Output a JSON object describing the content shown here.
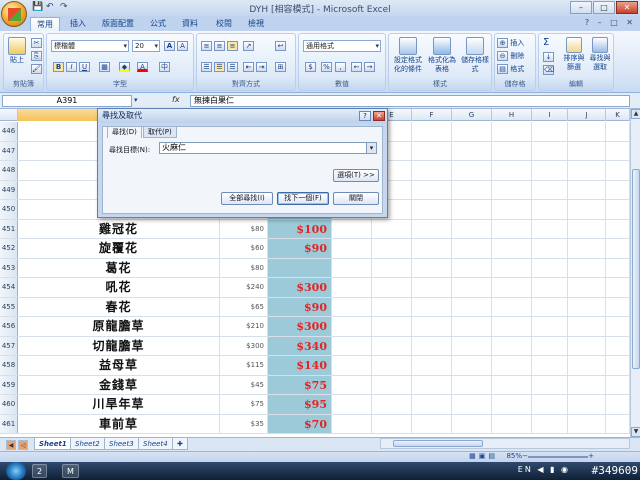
{
  "window": {
    "title": "DYH [相容模式] - Microsoft Excel",
    "qat": [
      "💾",
      "↶",
      "↷"
    ]
  },
  "tabs": [
    {
      "label": "常用",
      "active": true
    },
    {
      "label": "插入",
      "active": false
    },
    {
      "label": "版面配置",
      "active": false
    },
    {
      "label": "公式",
      "active": false
    },
    {
      "label": "資料",
      "active": false
    },
    {
      "label": "校閱",
      "active": false
    },
    {
      "label": "檢視",
      "active": false
    }
  ],
  "ribbon": {
    "clipboard": {
      "label": "剪貼簿",
      "paste": "貼上"
    },
    "font": {
      "label": "字型",
      "font_name": "標楷體",
      "font_size": "20",
      "grow": "A",
      "shrink": "A",
      "bold": "B",
      "italic": "I",
      "underline": "U",
      "fill_color": "#ffff00",
      "font_color": "#ff0000"
    },
    "alignment": {
      "label": "對齊方式"
    },
    "number": {
      "label": "數值",
      "format": "通用格式",
      "currency": "$",
      "percent": "%",
      "comma": ","
    },
    "styles": {
      "label": "樣式",
      "cond_format": "設定格式化的條件",
      "table_format": "格式化為表格",
      "cell_styles": "儲存格樣式"
    },
    "cells": {
      "label": "儲存格",
      "insert": "插入",
      "delete": "刪除",
      "format": "格式"
    },
    "editing": {
      "label": "編輯",
      "sum": "Σ",
      "sort": "排序與篩選",
      "find": "尋找與選取"
    }
  },
  "formula_bar": {
    "name_box": "A391",
    "fx": "fx",
    "content": "無揀白果仁"
  },
  "columns": [
    "D",
    "E",
    "F",
    "G",
    "H",
    "I",
    "J",
    "K"
  ],
  "rows": [
    {
      "num": "446",
      "name": "",
      "price": "",
      "sale": ""
    },
    {
      "num": "447",
      "name": "",
      "price": "",
      "sale": ""
    },
    {
      "num": "448",
      "name": "",
      "price": "",
      "sale": ""
    },
    {
      "num": "449",
      "name": "",
      "price": "",
      "sale": ""
    },
    {
      "num": "450",
      "name": "",
      "price": "",
      "sale": ""
    },
    {
      "num": "451",
      "name": "雞冠花",
      "price": "$80",
      "sale": "$100"
    },
    {
      "num": "452",
      "name": "旋覆花",
      "price": "$60",
      "sale": "$90"
    },
    {
      "num": "453",
      "name": "葛花",
      "price": "$80",
      "sale": ""
    },
    {
      "num": "454",
      "name": "吼花",
      "price": "$240",
      "sale": "$300"
    },
    {
      "num": "455",
      "name": "春花",
      "price": "$65",
      "sale": "$90"
    },
    {
      "num": "456",
      "name": "原龍膽草",
      "price": "$210",
      "sale": "$300"
    },
    {
      "num": "457",
      "name": "切龍膽草",
      "price": "$300",
      "sale": "$340"
    },
    {
      "num": "458",
      "name": "益母草",
      "price": "$115",
      "sale": "$140"
    },
    {
      "num": "459",
      "name": "金錢草",
      "price": "$45",
      "sale": "$75"
    },
    {
      "num": "460",
      "name": "川旱年草",
      "price": "$75",
      "sale": "$95"
    },
    {
      "num": "461",
      "name": "車前草",
      "price": "$35",
      "sale": "$70"
    }
  ],
  "sheets": [
    "Sheet1",
    "Sheet2",
    "Sheet3",
    "Sheet4"
  ],
  "status": {
    "zoom": "85%",
    "minus": "−",
    "plus": "+"
  },
  "taskbar": {
    "items": [
      "2",
      "M"
    ],
    "tray": "EN ◀ ▮ ◉",
    "watermark": "#349609"
  },
  "dialog": {
    "title": "尋找及取代",
    "help": "?",
    "close": "✕",
    "tab_find": "尋找(D)",
    "tab_replace": "取代(P)",
    "find_label": "尋找目標(N):",
    "find_value": "火麻仁",
    "options": "選項(T) >>",
    "find_all": "全部尋找(I)",
    "find_next": "找下一個(F)",
    "close_btn": "關閉"
  }
}
